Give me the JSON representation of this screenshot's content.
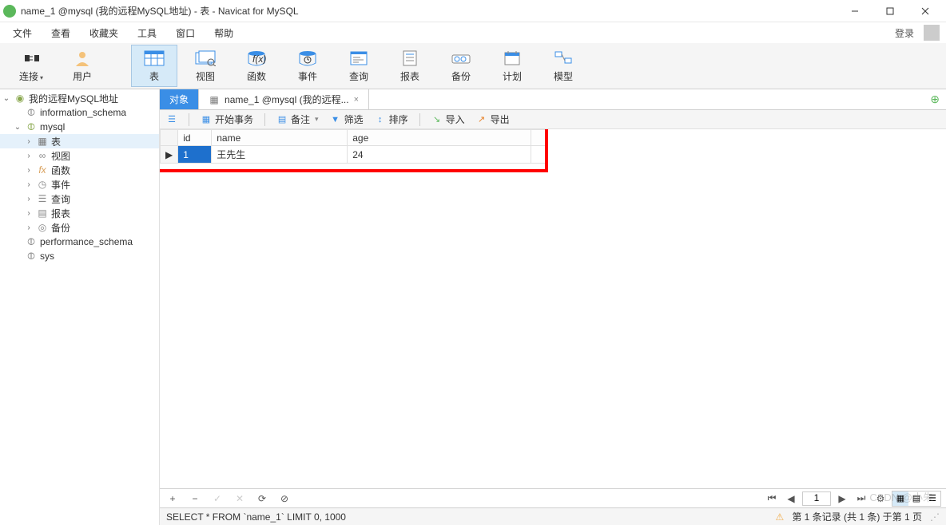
{
  "window": {
    "title": "name_1 @mysql (我的远程MySQL地址) - 表 - Navicat for MySQL"
  },
  "menu": {
    "items": [
      "文件",
      "查看",
      "收藏夹",
      "工具",
      "窗口",
      "帮助"
    ],
    "login": "登录"
  },
  "ribbon": {
    "connect": "连接",
    "user": "用户",
    "table": "表",
    "view": "视图",
    "function": "函数",
    "event": "事件",
    "query": "查询",
    "report": "报表",
    "backup": "备份",
    "schedule": "计划",
    "model": "模型"
  },
  "tree": {
    "root": "我的远程MySQL地址",
    "db1": "information_schema",
    "db2": "mysql",
    "tables": "表",
    "views": "视图",
    "functions": "函数",
    "events": "事件",
    "queries": "查询",
    "reports": "报表",
    "backups": "备份",
    "db3": "performance_schema",
    "db4": "sys"
  },
  "tabs": {
    "tab1": "对象",
    "tab2": "name_1 @mysql (我的远程..."
  },
  "table_toolbar": {
    "begin_tx": "开始事务",
    "memo": "备注",
    "filter": "筛选",
    "sort": "排序",
    "import": "导入",
    "export": "导出"
  },
  "grid": {
    "headers": {
      "id": "id",
      "name": "name",
      "age": "age"
    },
    "rows": [
      {
        "id": "1",
        "name": "王先生",
        "age": "24"
      }
    ]
  },
  "gridfooter": {
    "page": "1"
  },
  "statusbar": {
    "sql": "SELECT * FROM `name_1` LIMIT 0, 1000",
    "record": "第 1 条记录 (共 1 条) 于第 1 页"
  },
  "watermark": "CSDN @小朱"
}
